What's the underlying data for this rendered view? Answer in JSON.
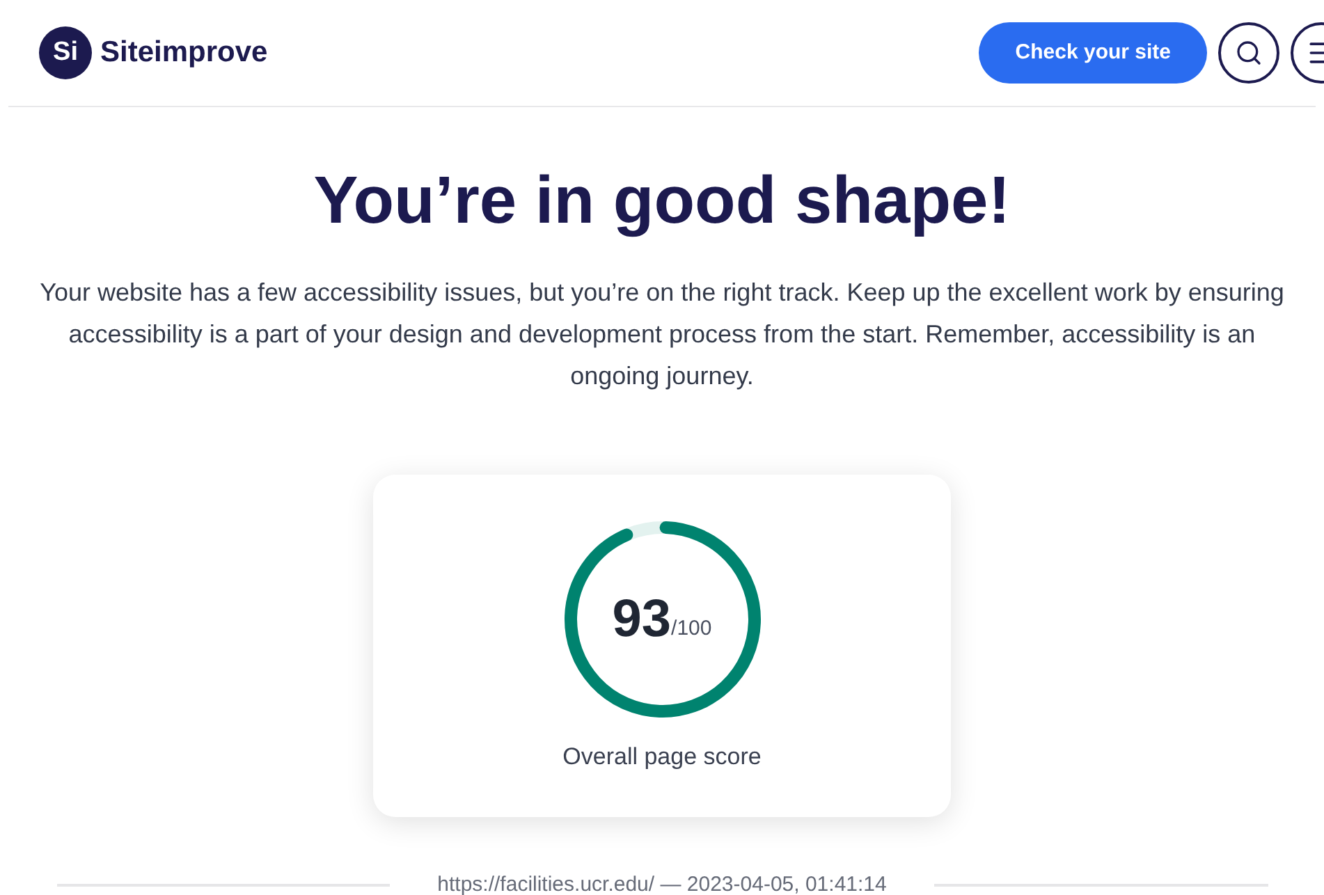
{
  "header": {
    "logo_mark": "Si",
    "logo_text": "Siteimprove",
    "cta": "Check your site"
  },
  "title": "You’re in good shape!",
  "description": "Your website has a few accessibility issues, but you’re on the right track. Keep up the excellent work by ensuring accessibility is a part of your design and development process from the start. Remember, accessibility is an ongoing journey.",
  "score": {
    "value": "93",
    "max": "/100",
    "level": 0.93,
    "label": "Overall page score"
  },
  "footer": {
    "text": "https://facilities.ucr.edu/ — 2023-04-05, 01:41:14"
  }
}
